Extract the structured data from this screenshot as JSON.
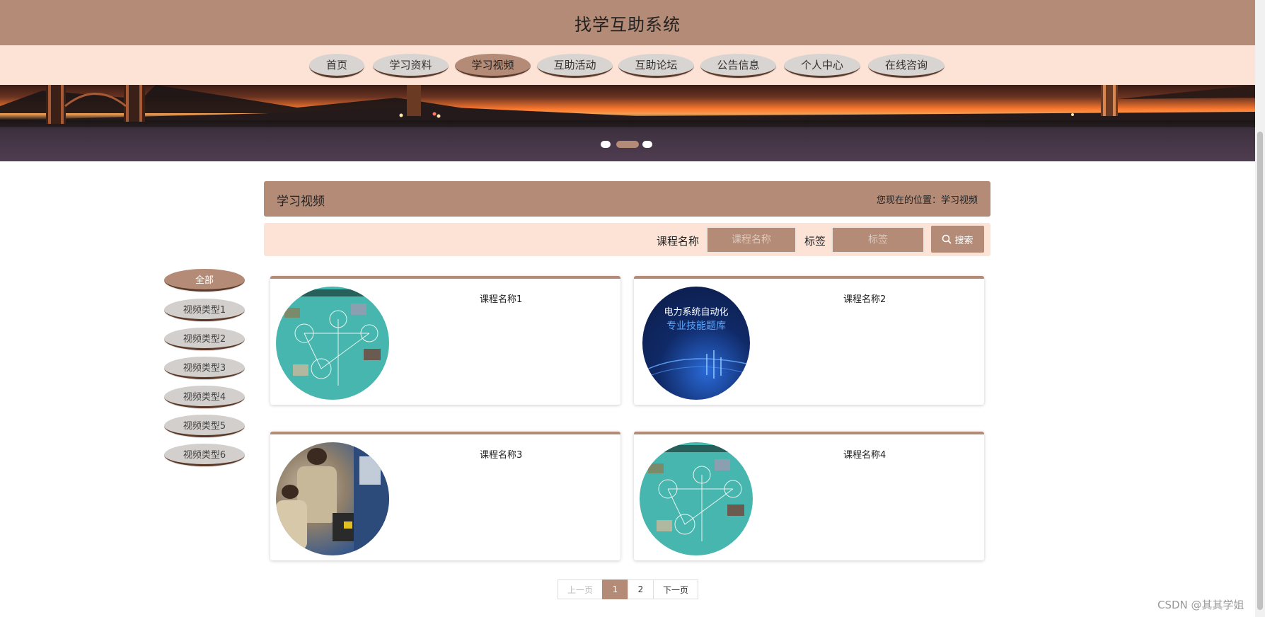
{
  "header": {
    "title": "找学互助系统"
  },
  "nav": {
    "items": [
      {
        "label": "首页"
      },
      {
        "label": "学习资料"
      },
      {
        "label": "学习视频"
      },
      {
        "label": "互助活动"
      },
      {
        "label": "互助论坛"
      },
      {
        "label": "公告信息"
      },
      {
        "label": "个人中心"
      },
      {
        "label": "在线咨询"
      }
    ],
    "active": "学习视频"
  },
  "carousel": {
    "slide_count": 3,
    "active_index": 1
  },
  "section": {
    "title": "学习视频",
    "breadcrumb_prefix": "您现在的位置：",
    "breadcrumb_current": "学习视频"
  },
  "search": {
    "course_label": "课程名称",
    "course_placeholder": "课程名称",
    "tag_label": "标签",
    "tag_placeholder": "标签",
    "button_label": "搜索"
  },
  "categories": [
    {
      "label": "全部"
    },
    {
      "label": "视频类型1"
    },
    {
      "label": "视频类型2"
    },
    {
      "label": "视频类型3"
    },
    {
      "label": "视频类型4"
    },
    {
      "label": "视频类型5"
    },
    {
      "label": "视频类型6"
    }
  ],
  "videos": [
    {
      "title": "课程名称1",
      "thumb_image": "power-system-diagram"
    },
    {
      "title": "课程名称2",
      "thumb_image": "book-cover",
      "thumb_text_1": "电力系统自动化",
      "thumb_text_2": "专业技能题库"
    },
    {
      "title": "课程名称3",
      "thumb_image": "workers-photo"
    },
    {
      "title": "课程名称4",
      "thumb_image": "power-system-diagram"
    }
  ],
  "pagination": {
    "prev_label": "上一页",
    "pages": [
      "1",
      "2"
    ],
    "current": "1",
    "next_label": "下一页"
  },
  "watermark": "CSDN @其其学姐",
  "colors": {
    "accent": "#b38b76",
    "nav_background": "#fde3d5",
    "pill_background": "#d8d4d2",
    "pill_border": "#5b3a2a",
    "diagram_teal": "#47b6ae"
  }
}
